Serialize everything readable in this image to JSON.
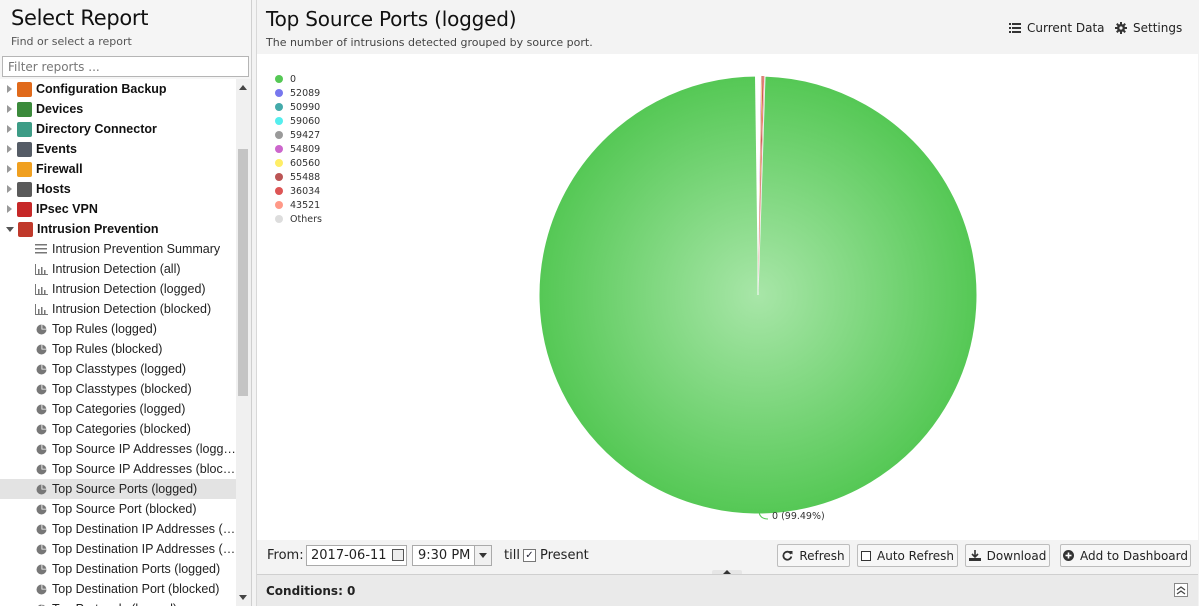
{
  "left": {
    "title": "Select Report",
    "subtitle": "Find or select a report",
    "filter_placeholder": "Filter reports ..."
  },
  "tree": [
    {
      "kind": "category",
      "label": "Configuration Backup",
      "icon": "backup-icon",
      "color": "#e06a1b"
    },
    {
      "kind": "category",
      "label": "Devices",
      "icon": "devices-icon",
      "color": "#3b8a3b"
    },
    {
      "kind": "category",
      "label": "Directory Connector",
      "icon": "directory-icon",
      "color": "#3d9c86"
    },
    {
      "kind": "category",
      "label": "Events",
      "icon": "events-icon",
      "color": "#555c66"
    },
    {
      "kind": "category",
      "label": "Firewall",
      "icon": "firewall-icon",
      "color": "#f0a020"
    },
    {
      "kind": "category",
      "label": "Hosts",
      "icon": "hosts-icon",
      "color": "#5a5a5a"
    },
    {
      "kind": "category",
      "label": "IPsec VPN",
      "icon": "lock-icon",
      "color": "#c62828"
    },
    {
      "kind": "category",
      "label": "Intrusion Prevention",
      "icon": "intrusion-icon",
      "color": "#c0392b",
      "open": true
    },
    {
      "kind": "leaf",
      "label": "Intrusion Prevention Summary",
      "icon": "list-icon"
    },
    {
      "kind": "leaf",
      "label": "Intrusion Detection (all)",
      "icon": "bar-chart-icon"
    },
    {
      "kind": "leaf",
      "label": "Intrusion Detection (logged)",
      "icon": "bar-chart-icon"
    },
    {
      "kind": "leaf",
      "label": "Intrusion Detection (blocked)",
      "icon": "bar-chart-icon"
    },
    {
      "kind": "leaf",
      "label": "Top Rules (logged)",
      "icon": "pie-chart-icon"
    },
    {
      "kind": "leaf",
      "label": "Top Rules (blocked)",
      "icon": "pie-chart-icon"
    },
    {
      "kind": "leaf",
      "label": "Top Classtypes (logged)",
      "icon": "pie-chart-icon"
    },
    {
      "kind": "leaf",
      "label": "Top Classtypes (blocked)",
      "icon": "pie-chart-icon"
    },
    {
      "kind": "leaf",
      "label": "Top Categories (logged)",
      "icon": "pie-chart-icon"
    },
    {
      "kind": "leaf",
      "label": "Top Categories (blocked)",
      "icon": "pie-chart-icon"
    },
    {
      "kind": "leaf",
      "label": "Top Source IP Addresses (logged)",
      "icon": "pie-chart-icon"
    },
    {
      "kind": "leaf",
      "label": "Top Source IP Addresses (blocked)",
      "icon": "pie-chart-icon"
    },
    {
      "kind": "leaf",
      "label": "Top Source Ports (logged)",
      "icon": "pie-chart-icon",
      "selected": true
    },
    {
      "kind": "leaf",
      "label": "Top Source Port (blocked)",
      "icon": "pie-chart-icon"
    },
    {
      "kind": "leaf",
      "label": "Top Destination IP Addresses (lo...",
      "icon": "pie-chart-icon"
    },
    {
      "kind": "leaf",
      "label": "Top Destination IP Addresses (blo...",
      "icon": "pie-chart-icon"
    },
    {
      "kind": "leaf",
      "label": "Top Destination Ports (logged)",
      "icon": "pie-chart-icon"
    },
    {
      "kind": "leaf",
      "label": "Top Destination Port (blocked)",
      "icon": "pie-chart-icon"
    },
    {
      "kind": "leaf",
      "label": "Top Protocols (logged)",
      "icon": "pie-chart-icon"
    }
  ],
  "report": {
    "title": "Top Source Ports (logged)",
    "subtitle": "The number of intrusions detected grouped by source port.",
    "current_data_label": "Current Data",
    "settings_label": "Settings"
  },
  "controls": {
    "from_label": "From:",
    "date_value": "2017-06-11",
    "time_value": "9:30 PM",
    "till_label": "till",
    "present_label": "Present",
    "present_checked": true,
    "refresh_label": "Refresh",
    "auto_refresh_label": "Auto Refresh",
    "download_label": "Download",
    "add_dashboard_label": "Add to Dashboard"
  },
  "conditions": {
    "label": "Conditions: 0"
  },
  "chart_data": {
    "type": "pie",
    "title": "",
    "legend_position": "top-left",
    "categories": [
      "0",
      "52089",
      "50990",
      "59060",
      "59427",
      "54809",
      "60560",
      "55488",
      "36034",
      "43521",
      "Others"
    ],
    "colors": [
      "#55c855",
      "#7777ee",
      "#44aaaa",
      "#55eeee",
      "#9a9a9a",
      "#cc66cc",
      "#ffee66",
      "#bb5555",
      "#dd5555",
      "#ff9988",
      "#dddddd"
    ],
    "values": [
      99.49,
      0.06,
      0.05,
      0.05,
      0.05,
      0.05,
      0.05,
      0.05,
      0.05,
      0.05,
      0.05
    ],
    "data_label": "0 (99.49%)"
  }
}
